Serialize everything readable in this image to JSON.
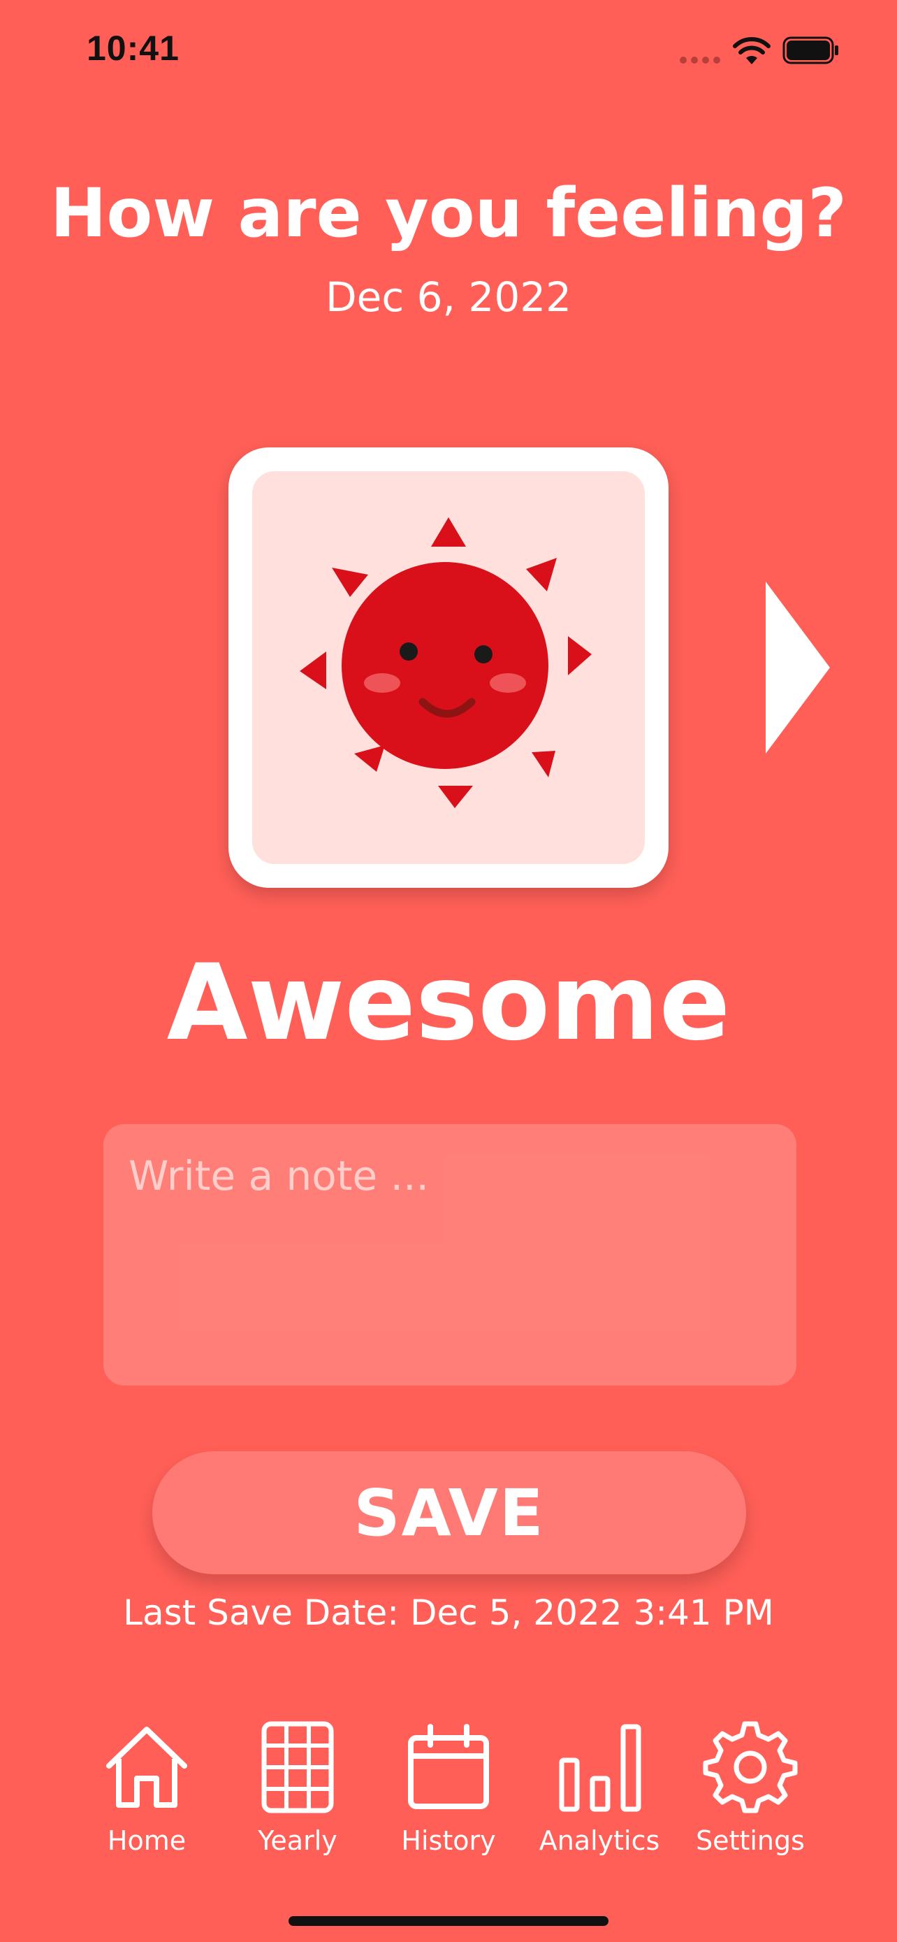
{
  "status_bar": {
    "time": "10:41"
  },
  "header": {
    "title": "How are you feeling?",
    "date": "Dec 6, 2022"
  },
  "mood": {
    "label": "Awesome",
    "icon": "smiling-sun-icon"
  },
  "note": {
    "placeholder": "Write a note ...",
    "value": ""
  },
  "save": {
    "label": "SAVE",
    "last_save": "Last Save Date: Dec 5, 2022 3:41 PM"
  },
  "tabs": [
    {
      "label": "Home",
      "icon": "home-icon"
    },
    {
      "label": "Yearly",
      "icon": "grid-icon"
    },
    {
      "label": "History",
      "icon": "calendar-icon"
    },
    {
      "label": "Analytics",
      "icon": "bar-chart-icon"
    },
    {
      "label": "Settings",
      "icon": "gear-icon"
    }
  ],
  "colors": {
    "background": "#FF5F57",
    "card_inner": "#FFE0DD",
    "sun": "#D9101A",
    "text": "#FFFFFF"
  }
}
